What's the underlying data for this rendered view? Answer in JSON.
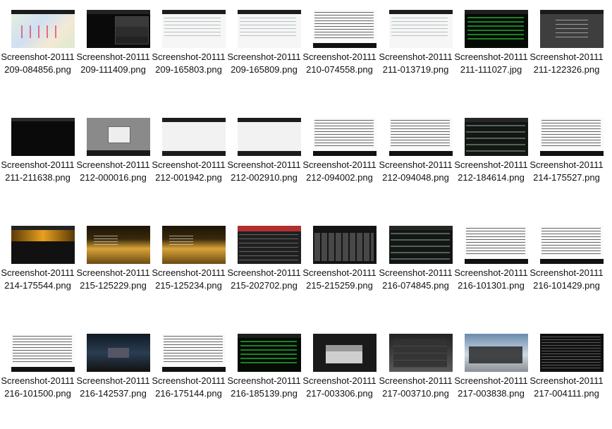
{
  "files": [
    {
      "name": "Screenshot-20111209-084856.png",
      "thumb": "map"
    },
    {
      "name": "Screenshot-20111209-111409.png",
      "thumb": "dialog"
    },
    {
      "name": "Screenshot-20111209-165803.png",
      "thumb": "white"
    },
    {
      "name": "Screenshot-20111209-165809.png",
      "thumb": "white"
    },
    {
      "name": "Screenshot-20111210-074558.png",
      "thumb": "term"
    },
    {
      "name": "Screenshot-20111211-013719.png",
      "thumb": "white"
    },
    {
      "name": "Screenshot-20111211-111027.jpg",
      "thumb": "green"
    },
    {
      "name": "Screenshot-20111211-122326.png",
      "thumb": "grey"
    },
    {
      "name": "Screenshot-20111211-211638.png",
      "thumb": "dark"
    },
    {
      "name": "Screenshot-20111212-000016.png",
      "thumb": "greybox"
    },
    {
      "name": "Screenshot-20111212-001942.png",
      "thumb": "whitebar"
    },
    {
      "name": "Screenshot-20111212-002910.png",
      "thumb": "whitebar"
    },
    {
      "name": "Screenshot-20111212-094002.png",
      "thumb": "term"
    },
    {
      "name": "Screenshot-20111212-094048.png",
      "thumb": "term"
    },
    {
      "name": "Screenshot-20111212-184614.png",
      "thumb": "list"
    },
    {
      "name": "Screenshot-20111214-175527.png",
      "thumb": "term"
    },
    {
      "name": "Screenshot-20111214-175544.png",
      "thumb": "orange"
    },
    {
      "name": "Screenshot-20111215-125229.png",
      "thumb": "gold"
    },
    {
      "name": "Screenshot-20111215-125234.png",
      "thumb": "gold"
    },
    {
      "name": "Screenshot-20111215-202702.png",
      "thumb": "app"
    },
    {
      "name": "Screenshot-20111215-215259.png",
      "thumb": "keys"
    },
    {
      "name": "Screenshot-20111216-074845.png",
      "thumb": "list"
    },
    {
      "name": "Screenshot-20111216-101301.png",
      "thumb": "term"
    },
    {
      "name": "Screenshot-20111216-101429.png",
      "thumb": "term"
    },
    {
      "name": "Screenshot-20111216-101500.png",
      "thumb": "term"
    },
    {
      "name": "Screenshot-20111216-142537.png",
      "thumb": "photo"
    },
    {
      "name": "Screenshot-20111216-175144.png",
      "thumb": "term"
    },
    {
      "name": "Screenshot-20111216-185139.png",
      "thumb": "green"
    },
    {
      "name": "Screenshot-20111217-003306.png",
      "thumb": "login"
    },
    {
      "name": "Screenshot-20111217-003710.png",
      "thumb": "menu"
    },
    {
      "name": "Screenshot-20111217-003838.png",
      "thumb": "sky"
    },
    {
      "name": "Screenshot-20111217-004111.png",
      "thumb": "log"
    }
  ]
}
